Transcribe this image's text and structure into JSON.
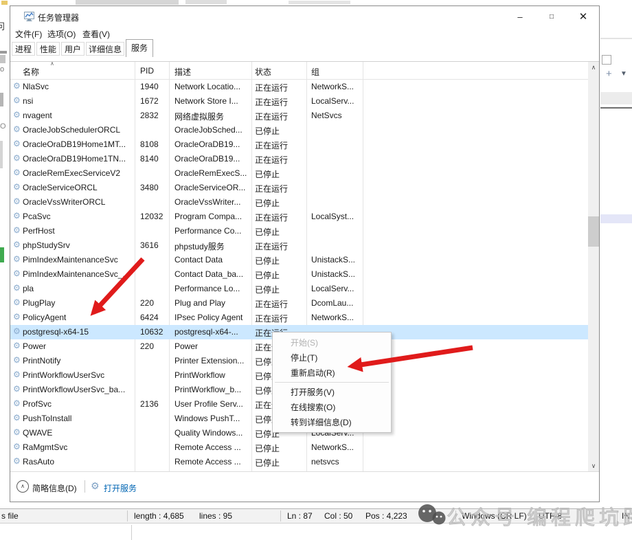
{
  "window": {
    "title": "任务管理器",
    "menu": {
      "file": "文件(F)",
      "options": "选项(O)",
      "view": "查看(V)"
    }
  },
  "tabs": [
    {
      "label": "进程",
      "active": false
    },
    {
      "label": "性能",
      "active": false
    },
    {
      "label": "用户",
      "active": false
    },
    {
      "label": "详细信息",
      "active": false
    },
    {
      "label": "服务",
      "active": true
    }
  ],
  "services": {
    "columns": {
      "name": "名称",
      "pid": "PID",
      "desc": "描述",
      "status": "状态",
      "group": "组"
    },
    "rows": [
      {
        "name": "NlaSvc",
        "pid": "1940",
        "desc": "Network Locatio...",
        "status": "正在运行",
        "group": "NetworkS...",
        "selected": false
      },
      {
        "name": "nsi",
        "pid": "1672",
        "desc": "Network Store I...",
        "status": "正在运行",
        "group": "LocalServ...",
        "selected": false
      },
      {
        "name": "nvagent",
        "pid": "2832",
        "desc": "网络虚拟服务",
        "status": "正在运行",
        "group": "NetSvcs",
        "selected": false
      },
      {
        "name": "OracleJobSchedulerORCL",
        "pid": "",
        "desc": "OracleJobSched...",
        "status": "已停止",
        "group": "",
        "selected": false
      },
      {
        "name": "OracleOraDB19Home1MT...",
        "pid": "8108",
        "desc": "OracleOraDB19...",
        "status": "正在运行",
        "group": "",
        "selected": false
      },
      {
        "name": "OracleOraDB19Home1TN...",
        "pid": "8140",
        "desc": "OracleOraDB19...",
        "status": "正在运行",
        "group": "",
        "selected": false
      },
      {
        "name": "OracleRemExecServiceV2",
        "pid": "",
        "desc": "OracleRemExecS...",
        "status": "已停止",
        "group": "",
        "selected": false
      },
      {
        "name": "OracleServiceORCL",
        "pid": "3480",
        "desc": "OracleServiceOR...",
        "status": "正在运行",
        "group": "",
        "selected": false
      },
      {
        "name": "OracleVssWriterORCL",
        "pid": "",
        "desc": "OracleVssWriter...",
        "status": "已停止",
        "group": "",
        "selected": false
      },
      {
        "name": "PcaSvc",
        "pid": "12032",
        "desc": "Program Compa...",
        "status": "正在运行",
        "group": "LocalSyst...",
        "selected": false
      },
      {
        "name": "PerfHost",
        "pid": "",
        "desc": "Performance Co...",
        "status": "已停止",
        "group": "",
        "selected": false
      },
      {
        "name": "phpStudySrv",
        "pid": "3616",
        "desc": "phpstudy服务",
        "status": "正在运行",
        "group": "",
        "selected": false
      },
      {
        "name": "PimIndexMaintenanceSvc",
        "pid": "",
        "desc": "Contact Data",
        "status": "已停止",
        "group": "UnistackS...",
        "selected": false
      },
      {
        "name": "PimIndexMaintenanceSvc_...",
        "pid": "",
        "desc": "Contact Data_ba...",
        "status": "已停止",
        "group": "UnistackS...",
        "selected": false
      },
      {
        "name": "pla",
        "pid": "",
        "desc": "Performance Lo...",
        "status": "已停止",
        "group": "LocalServ...",
        "selected": false
      },
      {
        "name": "PlugPlay",
        "pid": "220",
        "desc": "Plug and Play",
        "status": "正在运行",
        "group": "DcomLau...",
        "selected": false
      },
      {
        "name": "PolicyAgent",
        "pid": "6424",
        "desc": "IPsec Policy Agent",
        "status": "正在运行",
        "group": "NetworkS...",
        "selected": false
      },
      {
        "name": "postgresql-x64-15",
        "pid": "10632",
        "desc": "postgresql-x64-...",
        "status": "正在运行",
        "group": "",
        "selected": true
      },
      {
        "name": "Power",
        "pid": "220",
        "desc": "Power",
        "status": "正在运行",
        "group": "",
        "selected": false
      },
      {
        "name": "PrintNotify",
        "pid": "",
        "desc": "Printer Extension...",
        "status": "已停止",
        "group": "",
        "selected": false
      },
      {
        "name": "PrintWorkflowUserSvc",
        "pid": "",
        "desc": "PrintWorkflow",
        "status": "已停止",
        "group": "",
        "selected": false
      },
      {
        "name": "PrintWorkflowUserSvc_ba...",
        "pid": "",
        "desc": "PrintWorkflow_b...",
        "status": "已停止",
        "group": "",
        "selected": false
      },
      {
        "name": "ProfSvc",
        "pid": "2136",
        "desc": "User Profile Serv...",
        "status": "正在运行",
        "group": "",
        "selected": false
      },
      {
        "name": "PushToInstall",
        "pid": "",
        "desc": "Windows PushT...",
        "status": "已停止",
        "group": "",
        "selected": false
      },
      {
        "name": "QWAVE",
        "pid": "",
        "desc": "Quality Windows...",
        "status": "已停止",
        "group": "LocalServ...",
        "selected": false
      },
      {
        "name": "RaMgmtSvc",
        "pid": "",
        "desc": "Remote Access ...",
        "status": "已停止",
        "group": "NetworkS...",
        "selected": false
      },
      {
        "name": "RasAuto",
        "pid": "",
        "desc": "Remote Access ...",
        "status": "已停止",
        "group": "netsvcs",
        "selected": false
      }
    ]
  },
  "context_menu": {
    "items": [
      {
        "label": "开始(S)",
        "disabled": true
      },
      {
        "label": "停止(T)",
        "disabled": false
      },
      {
        "label": "重新启动(R)",
        "disabled": false
      },
      {
        "separator": true
      },
      {
        "label": "打开服务(V)",
        "disabled": false
      },
      {
        "label": "在线搜索(O)",
        "disabled": false
      },
      {
        "label": "转到详细信息(D)",
        "disabled": false
      }
    ]
  },
  "footer": {
    "summary": "简略信息(D)",
    "open_services": "打开服务"
  },
  "statusbar": {
    "left": "s file",
    "length": "length : 4,685",
    "lines": "lines : 95",
    "ln": "Ln : 87",
    "col": "Col : 50",
    "pos": "Pos : 4,223",
    "eol": "Windows (CR LF)",
    "encoding": "UTF-8",
    "ins": "IN"
  },
  "watermark": {
    "text1": "公众号",
    "text2": "编程爬坑路"
  },
  "background": {
    "frag1": "问",
    "frag2": "o",
    "frag3": "O"
  },
  "colors": {
    "selection": "#cce8ff",
    "link": "#0065b3",
    "arrow": "#e01b1b",
    "watermark": "#bdbdbd"
  }
}
